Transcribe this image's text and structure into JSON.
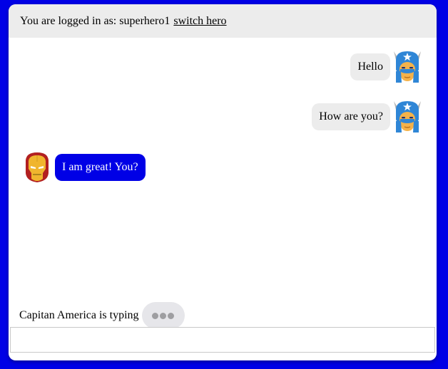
{
  "header": {
    "logged_in_label": "You are logged in as:",
    "username": "superhero1",
    "switch_link": "switch hero"
  },
  "messages": [
    {
      "text": "Hello",
      "direction": "outgoing",
      "avatar": "captain-america-icon"
    },
    {
      "text": "How are you?",
      "direction": "outgoing",
      "avatar": "captain-america-icon"
    },
    {
      "text": "I am great! You?",
      "direction": "incoming",
      "avatar": "iron-man-icon"
    }
  ],
  "typing": {
    "text": "Capitan America is typing"
  },
  "composer": {
    "value": "",
    "placeholder": ""
  },
  "colors": {
    "background": "#0000e6",
    "incoming_bubble": "#0000e6",
    "outgoing_bubble": "#ececec",
    "header": "#ececec"
  }
}
